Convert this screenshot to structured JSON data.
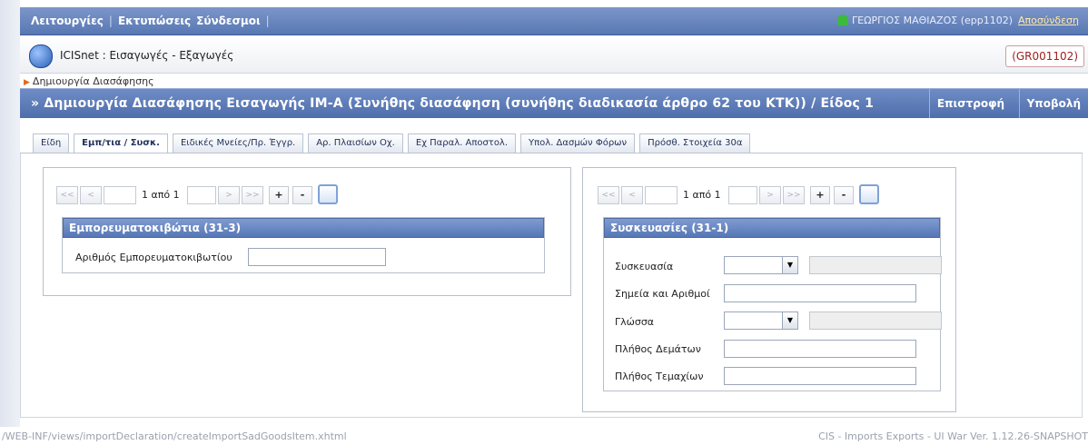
{
  "menu": {
    "items": [
      "Λειτουργίες",
      "Εκτυπώσεις",
      "Σύνδεσμοι"
    ]
  },
  "user": {
    "name": "ΓΕΩΡΓΙΟΣ ΜΑΘΙΑΖΟΣ (epp1102)",
    "logout": "Αποσύνδεση"
  },
  "app": {
    "title": "ICISnet : Εισαγωγές - Εξαγωγές",
    "code": "(GR001102)"
  },
  "breadcrumb": "Δημιουργία Διασάφησης",
  "page": {
    "title": "» Δημιουργία Διασάφησης Εισαγωγής IM-A (Συνήθης διασάφηση (συνήθης διαδικασία άρθρο 62 του ΚΤΚ)) / Είδος 1",
    "back": "Επιστροφή",
    "submit": "Υποβολή"
  },
  "tabs": [
    "Είδη",
    "Εμπ/τια / Συσκ.",
    "Ειδικές Μνείες/Πρ. Έγγρ.",
    "Αρ. Πλαισίων Οχ.",
    "Εχ Παραλ. Αποστολ.",
    "Υπολ. Δασμών Φόρων",
    "Πρόσθ. Στοιχεία 30α"
  ],
  "pager": {
    "first": "<<",
    "prev": "<",
    "next": ">",
    "last": ">>",
    "text": "1 από 1",
    "add": "+",
    "remove": "-"
  },
  "containers": {
    "legend": "Εμπορευματοκιβώτια (31-3)",
    "number_label": "Αριθμός Εμπορευματοκιβωτίου",
    "number_value": ""
  },
  "packages": {
    "legend": "Συσκευασίες (31-1)",
    "packaging_label": "Συσκευασία",
    "marks_label": "Σημεία και Αριθμοί",
    "language_label": "Γλώσσα",
    "bundles_label": "Πλήθος Δεμάτων",
    "pieces_label": "Πλήθος Τεμαχίων",
    "dropdown_glyph": "▼"
  },
  "footer": {
    "path": "/WEB-INF/views/importDeclaration/createImportSadGoodsItem.xhtml",
    "version": "CIS - Imports Exports - UI War Ver. 1.12.26-SNAPSHOT"
  }
}
